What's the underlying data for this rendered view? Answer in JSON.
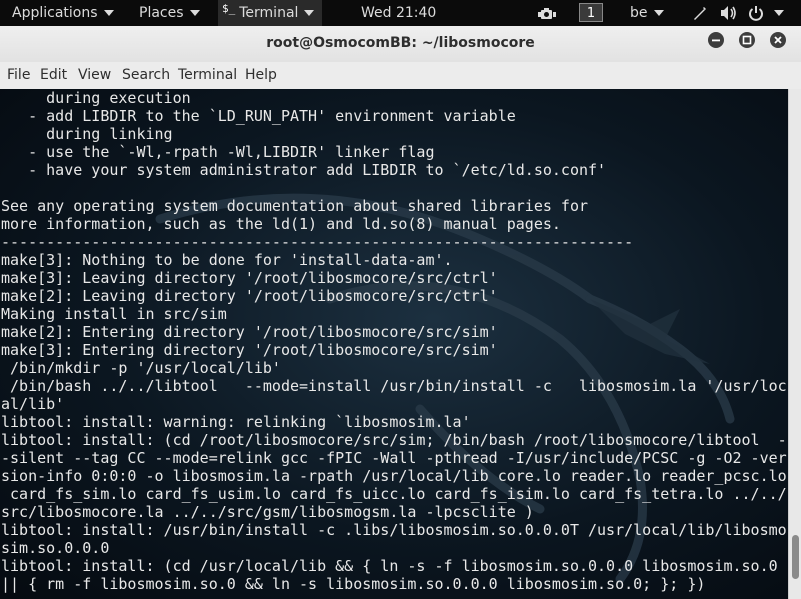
{
  "panel": {
    "applications": "Applications",
    "places": "Places",
    "terminal_app": "Terminal",
    "clock": "Wed 21:40",
    "workspace": "1",
    "keyboard_layout": "be"
  },
  "window": {
    "title": "root@OsmocomBB: ~/libosmocore",
    "controls": [
      "minimize",
      "maximize",
      "close"
    ]
  },
  "menu": [
    "File",
    "Edit",
    "View",
    "Search",
    "Terminal",
    "Help"
  ],
  "terminal": {
    "lines": [
      "     during execution",
      "   - add LIBDIR to the `LD_RUN_PATH' environment variable",
      "     during linking",
      "   - use the `-Wl,-rpath -Wl,LIBDIR' linker flag",
      "   - have your system administrator add LIBDIR to `/etc/ld.so.conf'",
      "",
      "See any operating system documentation about shared libraries for",
      "more information, such as the ld(1) and ld.so(8) manual pages.",
      "----------------------------------------------------------------------",
      "make[3]: Nothing to be done for 'install-data-am'.",
      "make[3]: Leaving directory '/root/libosmocore/src/ctrl'",
      "make[2]: Leaving directory '/root/libosmocore/src/ctrl'",
      "Making install in src/sim",
      "make[2]: Entering directory '/root/libosmocore/src/sim'",
      "make[3]: Entering directory '/root/libosmocore/src/sim'",
      " /bin/mkdir -p '/usr/local/lib'",
      " /bin/bash ../../libtool   --mode=install /usr/bin/install -c   libosmosim.la '/usr/loc",
      "al/lib'",
      "libtool: install: warning: relinking `libosmosim.la'",
      "libtool: install: (cd /root/libosmocore/src/sim; /bin/bash /root/libosmocore/libtool  -",
      "-silent --tag CC --mode=relink gcc -fPIC -Wall -pthread -I/usr/include/PCSC -g -O2 -ver",
      "sion-info 0:0:0 -o libosmosim.la -rpath /usr/local/lib core.lo reader.lo reader_pcsc.lo",
      " card_fs_sim.lo card_fs_usim.lo card_fs_uicc.lo card_fs_isim.lo card_fs_tetra.lo ../../",
      "src/libosmocore.la ../../src/gsm/libosmogsm.la -lpcsclite )",
      "libtool: install: /usr/bin/install -c .libs/libosmosim.so.0.0.0T /usr/local/lib/libosmo",
      "sim.so.0.0.0",
      "libtool: install: (cd /usr/local/lib && { ln -s -f libosmosim.so.0.0.0 libosmosim.so.0",
      "|| { rm -f libosmosim.so.0 && ln -s libosmosim.so.0.0.0 libosmosim.so.0; }; })"
    ]
  }
}
